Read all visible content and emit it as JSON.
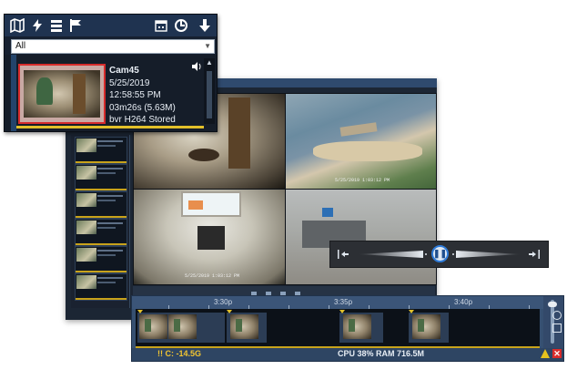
{
  "panel": {
    "toolbar_icons": [
      "map-icon",
      "bolt-icon",
      "layers-icon",
      "flag-icon",
      "download-icon",
      "calendar-icon",
      "backup-icon",
      "search-icon"
    ],
    "filter": {
      "selected": "All"
    },
    "clip": {
      "camera": "Cam45",
      "date": "5/25/2019",
      "time": "12:58:55 PM",
      "duration": "03m26s (5.63M)",
      "storage": "bvr H264 Stored"
    }
  },
  "background": {
    "timestamps": {
      "cam2": "5/25/2019 1:03:12 PM",
      "cam3": "5/25/2019 1:03:12 PM"
    }
  },
  "timeline": {
    "time_labels": [
      "3:30p",
      "3:35p",
      "3:40p"
    ],
    "status": {
      "disk": "!! C: -14.5G",
      "cpu": "CPU 38% RAM 716.5M"
    }
  },
  "colors": {
    "accent": "#2f7bd8",
    "warning": "#e6c21e",
    "error": "#d92b2b",
    "panel_bg": "#162030",
    "timeline_bg": "#365071",
    "selection": "#d62c2c"
  }
}
